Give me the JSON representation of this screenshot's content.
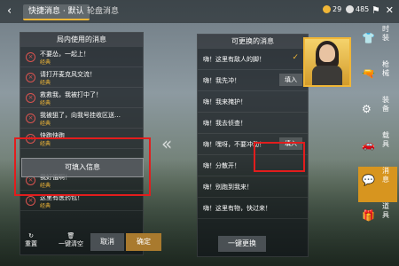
{
  "topbar": {
    "back_icon": "back-arrow-icon",
    "tab_active": "快捷消息 · 默认",
    "tab_inactive": "轮盘消息",
    "currencies": [
      {
        "icon": "gold-coin-icon",
        "value": "29",
        "color": "#f0b637"
      },
      {
        "icon": "silver-coin-icon",
        "value": "485",
        "color": "#e0e0e0"
      }
    ],
    "right_icons": [
      "flag-icon",
      "close-icon"
    ]
  },
  "left_panel": {
    "title": "局内使用的消息",
    "items": [
      {
        "text": "不要怂，一起上！",
        "sub": "经典"
      },
      {
        "text": "请打开麦克风交流！",
        "sub": "经典"
      },
      {
        "text": "救救我，我被打中了！",
        "sub": "经典"
      },
      {
        "text": "我被狙了，向我号挂收区送…",
        "sub": "经典"
      },
      {
        "text": "快跑快跑",
        "sub": "经典"
      },
      {
        "text": "我好饿啊！",
        "sub": "经典"
      },
      {
        "text": "这里有医药包！",
        "sub": "经典"
      }
    ],
    "add_button": "可填入信息",
    "reset_label": "重置",
    "clear_label": "一键清空",
    "cancel": "取消",
    "confirm": "确定"
  },
  "right_panel": {
    "title": "可更换的消息",
    "items": [
      {
        "text": "嗨！这里有敌人的脚！",
        "selected": true
      },
      {
        "text": "嗨！我先冲！",
        "fill": "填入"
      },
      {
        "text": "嗨！我来掩护！",
        "fill": ""
      },
      {
        "text": "嗨！我去侦查！",
        "fill": ""
      },
      {
        "text": "嗨！嘿呀，不要冲动！",
        "fill": "填入"
      },
      {
        "text": "嗨！分散开！",
        "fill": ""
      },
      {
        "text": "嗨！别跑到我来！",
        "fill": ""
      },
      {
        "text": "嗨！这里有物，快过来！",
        "fill": ""
      }
    ],
    "onekey": "一键更换"
  },
  "sidebar": [
    {
      "icon": "coat-icon",
      "label": "时装"
    },
    {
      "icon": "gun-icon",
      "label": "枪械"
    },
    {
      "icon": "gear-icon",
      "label": "装备"
    },
    {
      "icon": "vehicle-icon",
      "label": "载具"
    },
    {
      "icon": "message-icon",
      "label": "消息",
      "active": true
    },
    {
      "icon": "prop-icon",
      "label": "道具"
    }
  ]
}
